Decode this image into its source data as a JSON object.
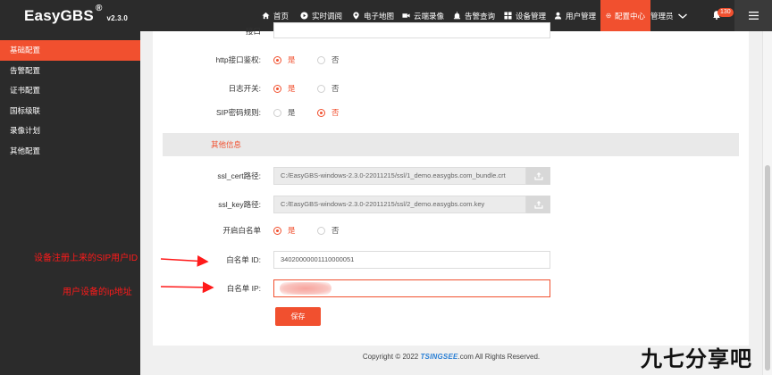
{
  "app": {
    "name": "EasyGBS",
    "reg_mark": "®",
    "version": "v2.3.0"
  },
  "nav": [
    {
      "label": "首页",
      "icon": "home-icon"
    },
    {
      "label": "实时调阅",
      "icon": "play-icon"
    },
    {
      "label": "电子地图",
      "icon": "map-pin-icon"
    },
    {
      "label": "云端录像",
      "icon": "video-icon"
    },
    {
      "label": "告警查询",
      "icon": "alarm-icon"
    },
    {
      "label": "设备管理",
      "icon": "grid-icon"
    },
    {
      "label": "用户管理",
      "icon": "user-icon"
    },
    {
      "label": "配置中心",
      "icon": "gear-icon",
      "active": true
    }
  ],
  "user": {
    "label": "管理员",
    "notifications": "130"
  },
  "sidebar": {
    "items": [
      {
        "label": "基础配置",
        "active": true
      },
      {
        "label": "告警配置"
      },
      {
        "label": "证书配置"
      },
      {
        "label": "国标级联"
      },
      {
        "label": "录像计划"
      },
      {
        "label": "其他配置"
      }
    ]
  },
  "form": {
    "partial_top_label": "接口",
    "http_auth": {
      "label": "http接口鉴权:",
      "yes": "是",
      "no": "否",
      "value": "是"
    },
    "log_switch": {
      "label": "日志开关:",
      "yes": "是",
      "no": "否",
      "value": "是"
    },
    "sip_password": {
      "label": "SIP密码规则:",
      "yes": "是",
      "no": "否",
      "value": "否"
    },
    "section_title": "其他信息",
    "ssl_cert": {
      "label": "ssl_cert路径:",
      "value": "C:/EasyGBS-windows-2.3.0-22011215/ssl/1_demo.easygbs.com_bundle.crt"
    },
    "ssl_key": {
      "label": "ssl_key路径:",
      "value": "C:/EasyGBS-windows-2.3.0-22011215/ssl/2_demo.easygbs.com.key"
    },
    "whitelist_switch": {
      "label": "开启白名单",
      "yes": "是",
      "no": "否",
      "value": "是"
    },
    "whitelist_id": {
      "label": "白名单 ID:",
      "value": "34020000001110000051"
    },
    "whitelist_ip": {
      "label": "白名单 IP:",
      "value": ""
    },
    "save_label": "保存"
  },
  "footer": {
    "prefix": "Copyright © 2022 ",
    "logo": "TSINGSEE",
    "suffix": ".com All Rights Reserved."
  },
  "annotations": {
    "sip_id_note": "设备注册上来的SIP用户ID",
    "ip_note": "用户设备的ip地址"
  },
  "watermark": "九七分享吧",
  "colors": {
    "accent": "#f1502f",
    "dark": "#2b2b2b",
    "annotation": "#ff1a1a"
  }
}
